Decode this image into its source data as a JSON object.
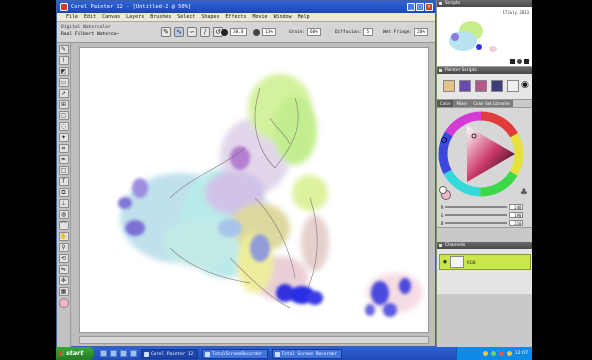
{
  "app": {
    "title": "Corel Painter 12 - [Untitled-2 @ 50%]",
    "window_buttons": [
      "_",
      "□",
      "×"
    ]
  },
  "menu": [
    "File",
    "Edit",
    "Canvas",
    "Layers",
    "Brushes",
    "Select",
    "Shapes",
    "Effects",
    "Movie",
    "Window",
    "Help"
  ],
  "property_bar": {
    "brush_category": "Digital Watercolor",
    "brush_variant": "Real Filbert Waterco~",
    "size_value": "30.0",
    "opacity_value": "13%",
    "grain_label": "Grain:",
    "grain_value": "60%",
    "diffusion_label": "Diffusion:",
    "diffusion_value": "5",
    "wet_fringe_label": "Wet Fringe:",
    "wet_fringe_value": "20%"
  },
  "panels": {
    "scripts": {
      "title": "Scripts",
      "date": "17July 2013"
    },
    "painter_scripts": {
      "title": "Painter Scripts"
    },
    "color": {
      "tabs": [
        "Color",
        "Mixer",
        "Color Set Libraries"
      ],
      "sliders": [
        {
          "label": "R",
          "value": "248"
        },
        {
          "label": "G",
          "value": "190"
        },
        {
          "label": "B",
          "value": "210"
        }
      ]
    },
    "channels": {
      "title": "Channels",
      "layer_label": "RGB"
    }
  },
  "taskbar": {
    "start": "start",
    "tasks": [
      "Corel Painter 12",
      "TotalScreenRecorder",
      "Total Screen Recorder"
    ],
    "clock": "12:07"
  },
  "colors": {
    "title_blue": "#1f4bb8",
    "channel_green": "#c8e84a",
    "current_color": "#f4b6c6"
  }
}
